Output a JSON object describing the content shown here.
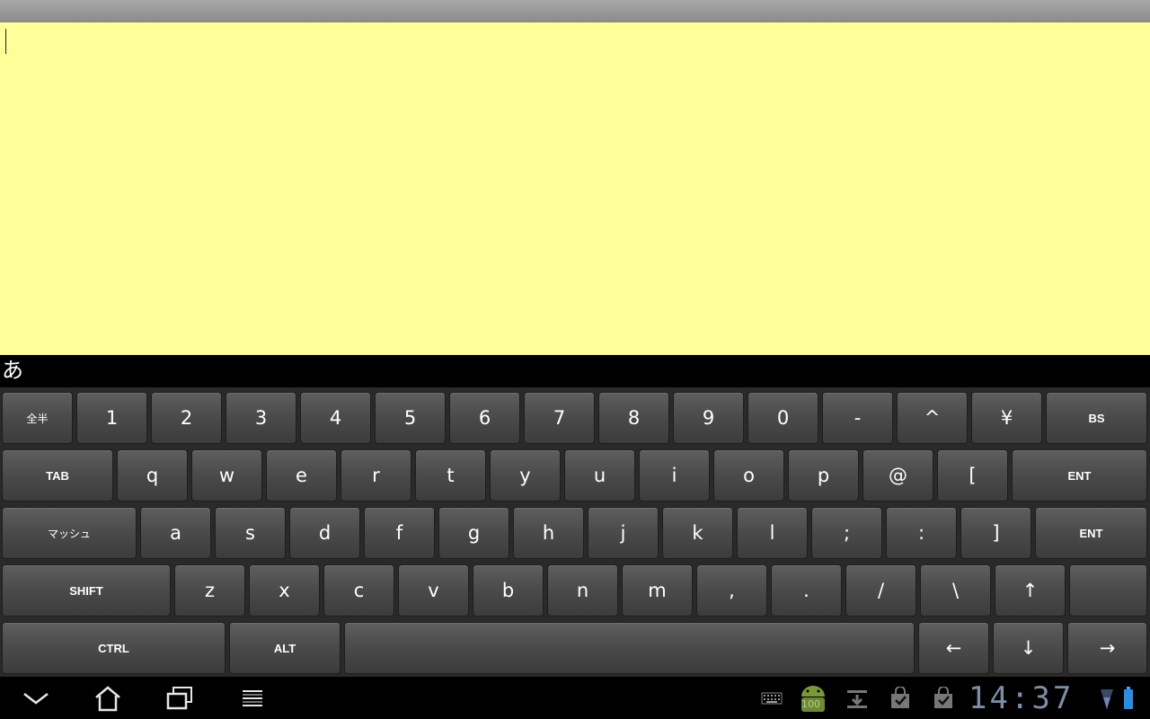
{
  "ime": {
    "mode_label": "あ"
  },
  "keyboard": {
    "row1": [
      "全半",
      "1",
      "2",
      "3",
      "4",
      "5",
      "6",
      "7",
      "8",
      "9",
      "0",
      "-",
      "^",
      "¥",
      "BS"
    ],
    "row2": [
      "TAB",
      "q",
      "w",
      "e",
      "r",
      "t",
      "y",
      "u",
      "i",
      "o",
      "p",
      "@",
      "[",
      "ENT"
    ],
    "row3": [
      "マッシュ",
      "a",
      "s",
      "d",
      "f",
      "g",
      "h",
      "j",
      "k",
      "l",
      ";",
      ":",
      "]",
      "ENT"
    ],
    "row4": [
      "SHIFT",
      "z",
      "x",
      "c",
      "v",
      "b",
      "n",
      "m",
      ",",
      ".",
      "/",
      "\\",
      "↑",
      ""
    ],
    "row5": [
      "CTRL",
      "ALT",
      "",
      "←",
      "↓",
      "→"
    ]
  },
  "status": {
    "time": "14:37",
    "battery_badge": "100"
  },
  "icons": {
    "nav": [
      "back-icon",
      "home-icon",
      "recent-apps-icon",
      "menu-icon"
    ],
    "status": [
      "keyboard-icon",
      "android-icon",
      "download-icon",
      "shopping-bag-icon",
      "shopping-bag-icon",
      "signal-icon",
      "battery-icon"
    ]
  }
}
